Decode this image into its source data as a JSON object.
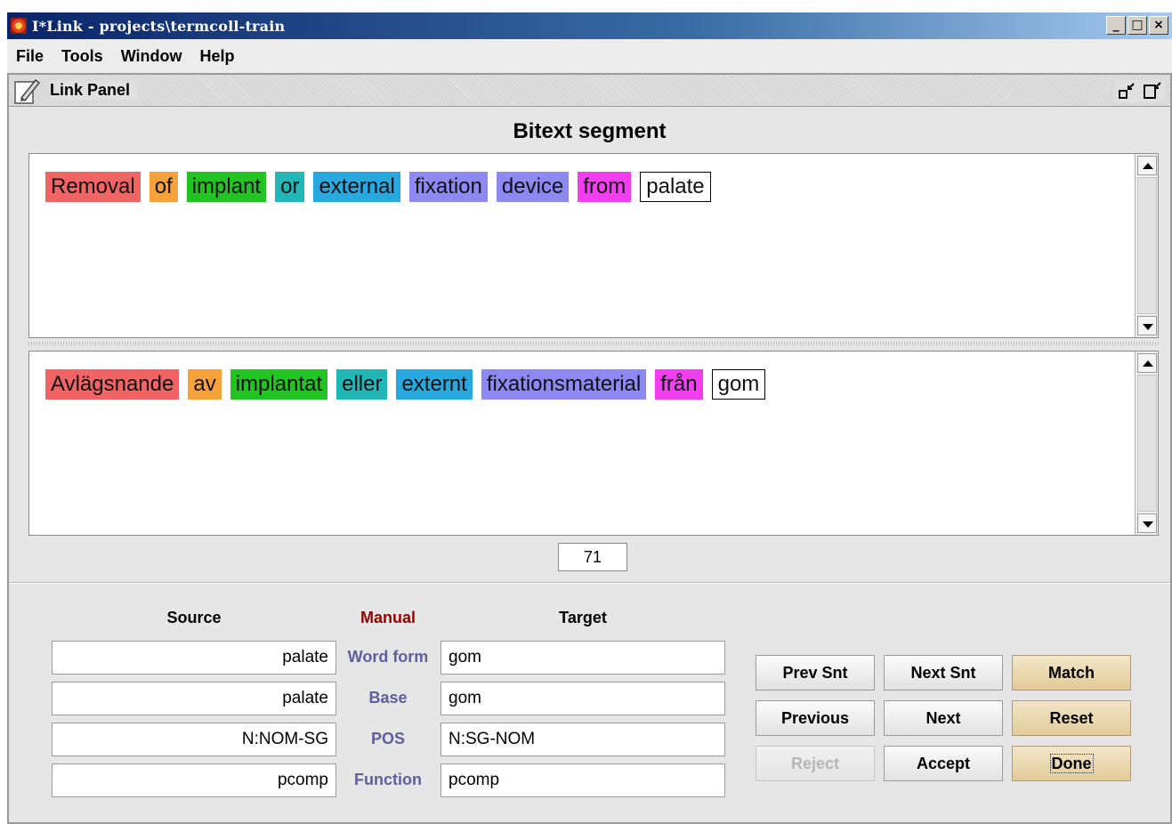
{
  "window": {
    "title": "I*Link - projects\\termcoll-train",
    "controls": [
      "_",
      "□",
      "×"
    ]
  },
  "menu": [
    "File",
    "Tools",
    "Window",
    "Help"
  ],
  "panel": {
    "title": "Link Panel"
  },
  "bitext": {
    "heading": "Bitext segment",
    "source_tokens": [
      {
        "text": "Removal",
        "color": "#f26363"
      },
      {
        "text": "of",
        "color": "#f7a13b"
      },
      {
        "text": "implant",
        "color": "#22c422"
      },
      {
        "text": "or",
        "color": "#21b7b7"
      },
      {
        "text": "external",
        "color": "#27a8de"
      },
      {
        "text": "fixation",
        "color": "#8e88f4"
      },
      {
        "text": "device",
        "color": "#8e88f4"
      },
      {
        "text": "from",
        "color": "#f23ef0"
      },
      {
        "text": "palate",
        "color": null
      }
    ],
    "target_tokens": [
      {
        "text": "Avlägsnande",
        "color": "#f26363"
      },
      {
        "text": "av",
        "color": "#f7a13b"
      },
      {
        "text": "implantat",
        "color": "#22c422"
      },
      {
        "text": "eller",
        "color": "#21b7b7"
      },
      {
        "text": "externt",
        "color": "#27a8de"
      },
      {
        "text": "fixationsmaterial",
        "color": "#8e88f4"
      },
      {
        "text": "från",
        "color": "#f23ef0"
      },
      {
        "text": "gom",
        "color": null
      }
    ],
    "segment_number": "71"
  },
  "link": {
    "source_header": "Source",
    "manual_header": "Manual",
    "target_header": "Target",
    "rows": [
      {
        "label": "Word form",
        "source": "palate",
        "target": "gom"
      },
      {
        "label": "Base",
        "source": "palate",
        "target": "gom"
      },
      {
        "label": "POS",
        "source": "N:NOM-SG",
        "target": "N:SG-NOM"
      },
      {
        "label": "Function",
        "source": "pcomp",
        "target": "pcomp"
      }
    ]
  },
  "buttons": {
    "prev_snt": "Prev Snt",
    "next_snt": "Next Snt",
    "match": "Match",
    "previous": "Previous",
    "next": "Next",
    "reset": "Reset",
    "reject": "Reject",
    "accept": "Accept",
    "done": "Done"
  },
  "colors": {
    "manual_header": "#990000",
    "row_label": "#5e5f9a",
    "gold_button": "#e2cb98"
  }
}
